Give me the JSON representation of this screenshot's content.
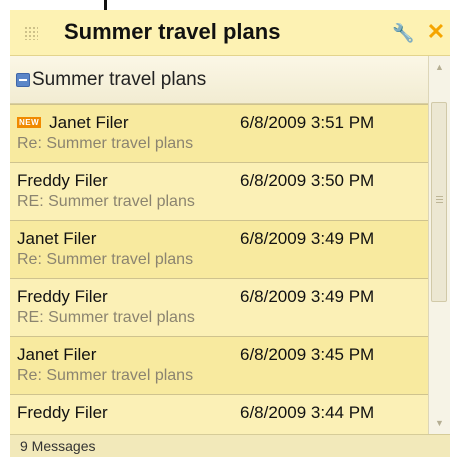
{
  "gadget": {
    "title": "Summer travel plans",
    "icons": [
      "grip-icon",
      "wrench-icon",
      "close-icon"
    ],
    "wrench_glyph": "🔧",
    "close_glyph": "✕"
  },
  "conversation": {
    "title": "Summer travel plans",
    "collapse_icon": "minus-box-icon"
  },
  "messages": [
    {
      "badge": "NEW",
      "sender": "Janet Filer",
      "date": "6/8/2009  3:51 PM",
      "subject": "Re: Summer travel plans"
    },
    {
      "badge": "",
      "sender": "Freddy Filer",
      "date": "6/8/2009  3:50 PM",
      "subject": "RE: Summer travel plans"
    },
    {
      "badge": "",
      "sender": "Janet Filer",
      "date": "6/8/2009  3:49 PM",
      "subject": "Re: Summer travel plans"
    },
    {
      "badge": "",
      "sender": "Freddy Filer",
      "date": "6/8/2009  3:49 PM",
      "subject": "RE: Summer travel plans"
    },
    {
      "badge": "",
      "sender": "Janet Filer",
      "date": "6/8/2009  3:45 PM",
      "subject": "Re: Summer travel plans"
    },
    {
      "badge": "",
      "sender": "Freddy Filer",
      "date": "6/8/2009  3:44 PM",
      "subject": ""
    }
  ],
  "status": {
    "count": "9 Messages"
  },
  "colors": {
    "background": "#fdf2b3",
    "accent": "#f5a500",
    "badge": "#f08a00",
    "subject_text": "#8b8470"
  }
}
